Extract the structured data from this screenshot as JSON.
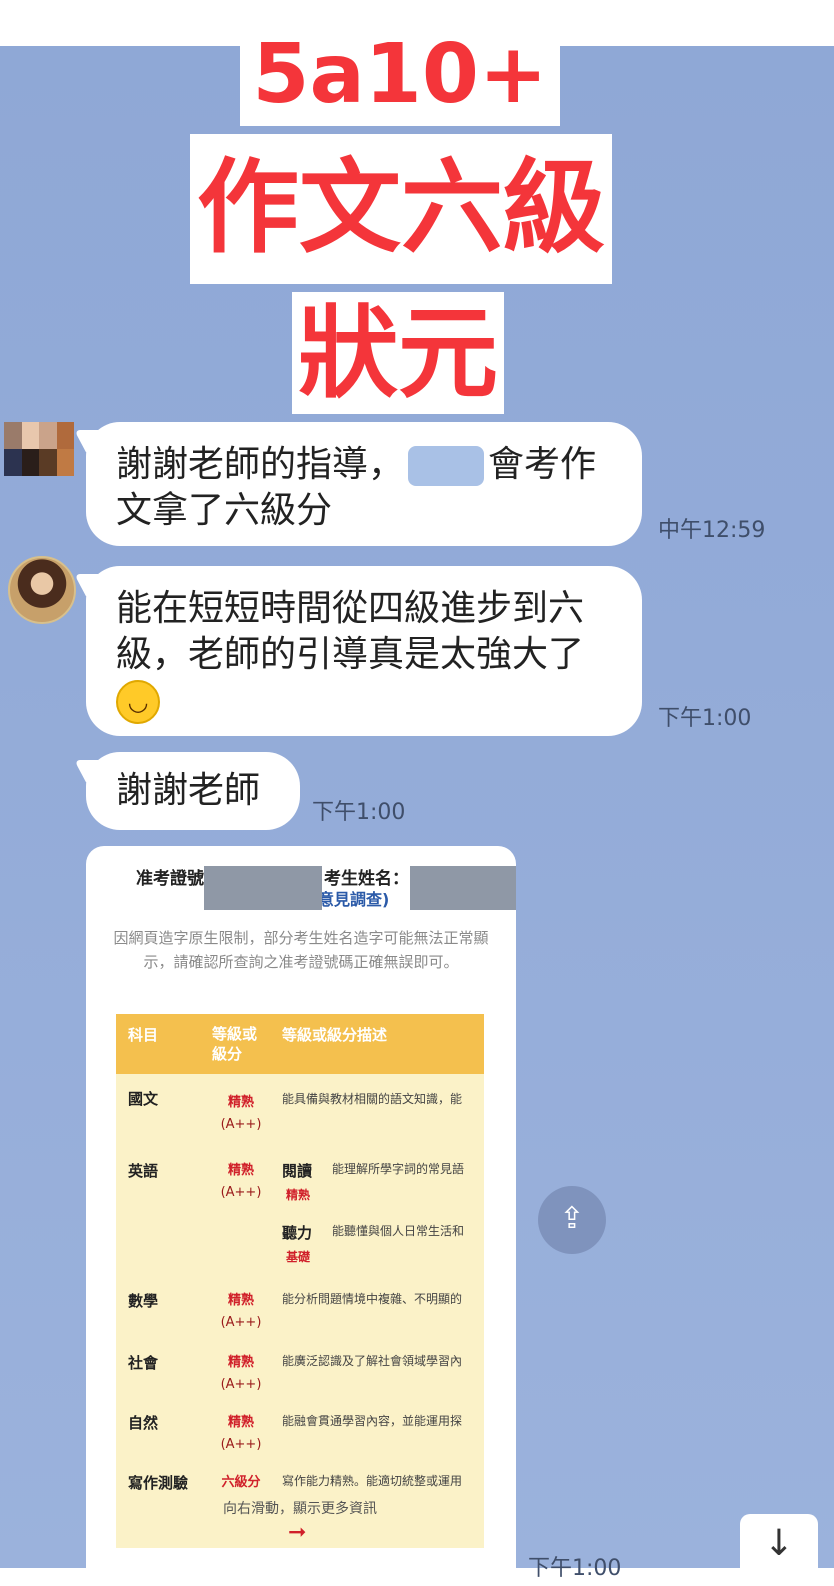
{
  "banner": {
    "line1": "5a10+",
    "line2": "作文六級",
    "line3": "狀元"
  },
  "messages": [
    {
      "text_before": "謝謝老師的指導，",
      "text_after": "會考作文拿了六級分",
      "time": "中午12:59"
    },
    {
      "text": "能在短短時間從四級進步到六級，老師的引導真是太強大了",
      "emoji": "😊",
      "time": "下午1:00"
    },
    {
      "text": "謝謝老師",
      "time": "下午1:00"
    }
  ],
  "card": {
    "admission_no_label": "准考證號",
    "name_label": "考生姓名：",
    "survey_link": "意見調查)",
    "notice": "因網頁造字原生限制，部分考生姓名造字可能無法正常顯示，請確認所查詢之准考證號碼正確無誤即可。",
    "headers": [
      "科目",
      "等級或級分",
      "等級或級分描述"
    ],
    "rows": [
      {
        "subject": "國文",
        "level": "精熟",
        "mark": "(A++)",
        "desc": "能具備與教材相關的語文知識，能"
      },
      {
        "subject": "英語",
        "level": "精熟",
        "mark": "(A++)",
        "sub1": "閱讀",
        "sub1_level": "精熟",
        "sub1_desc": "能理解所學字詞的常見語",
        "sub2": "聽力",
        "sub2_level": "基礎",
        "sub2_desc": "能聽懂與個人日常生活和"
      },
      {
        "subject": "數學",
        "level": "精熟",
        "mark": "(A++)",
        "desc": "能分析問題情境中複雜、不明顯的"
      },
      {
        "subject": "社會",
        "level": "精熟",
        "mark": "(A++)",
        "desc": "能廣泛認識及了解社會領域學習內"
      },
      {
        "subject": "自然",
        "level": "精熟",
        "mark": "(A++)",
        "desc": "能融會貫通學習內容，並能運用探"
      },
      {
        "subject": "寫作測驗",
        "level": "六級分",
        "desc": "寫作能力精熟。能適切統整或運用"
      }
    ],
    "swipe_hint": "向右滑動，顯示更多資訊",
    "swipe_arrow": "➞",
    "time": "下午1:00"
  },
  "buttons": {
    "share_glyph": "⇪",
    "scroll_glyph": "↓"
  }
}
